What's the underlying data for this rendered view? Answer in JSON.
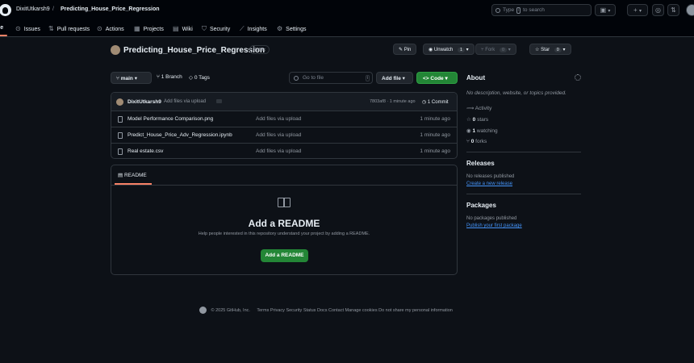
{
  "header": {
    "owner": "DixitUtkarsh9",
    "separator": "/",
    "repo": "Predicting_House_Price_Regression",
    "search_placeholder_pre": "Type",
    "search_key": "/",
    "search_placeholder_post": "to search",
    "plus": "+",
    "caret": "▾"
  },
  "tabs": [
    {
      "label": "de",
      "icon": "code-icon"
    },
    {
      "label": "Issues",
      "icon": "issue-icon"
    },
    {
      "label": "Pull requests",
      "icon": "pull-request-icon"
    },
    {
      "label": "Actions",
      "icon": "play-icon"
    },
    {
      "label": "Projects",
      "icon": "table-icon"
    },
    {
      "label": "Wiki",
      "icon": "book-icon"
    },
    {
      "label": "Security",
      "icon": "shield-icon"
    },
    {
      "label": "Insights",
      "icon": "graph-icon"
    },
    {
      "label": "Settings",
      "icon": "gear-icon"
    }
  ],
  "repo": {
    "title": "Predicting_House_Price_Regression",
    "visibility": "Public",
    "pin": "Pin",
    "unwatch": "Unwatch",
    "unwatch_count": "1",
    "fork": "Fork",
    "fork_count": "0",
    "star": "Star",
    "star_count": "0"
  },
  "filenav": {
    "branch": "main",
    "branch_count": "1 Branch",
    "tags": "0 Tags",
    "goto_placeholder": "Go to file",
    "goto_key": "t",
    "add_file": "Add file",
    "code": "Code"
  },
  "commit": {
    "user": "DixitUtkarsh9",
    "message": "Add files via upload",
    "sha_time": "7803af8 · 1 minute ago",
    "commits": "1 Commit"
  },
  "files": [
    {
      "name": "Model Performance Comparison.png",
      "message": "Add files via upload",
      "time": "1 minute ago"
    },
    {
      "name": "Predict_House_Price_Adv_Regression.ipynb",
      "message": "Add files via upload",
      "time": "1 minute ago"
    },
    {
      "name": "Real estate.csv",
      "message": "Add files via upload",
      "time": "1 minute ago"
    }
  ],
  "readme": {
    "tab": "README",
    "heading": "Add a README",
    "text": "Help people interested in this repository understand your project by adding a README.",
    "button": "Add a README"
  },
  "about": {
    "title": "About",
    "description": "No description, website, or topics provided.",
    "activity": "Activity",
    "stars_n": "0",
    "stars_label": "stars",
    "watching_n": "1",
    "watching_label": "watching",
    "forks_n": "0",
    "forks_label": "forks"
  },
  "releases": {
    "title": "Releases",
    "text": "No releases published",
    "link": "Create a new release"
  },
  "packages": {
    "title": "Packages",
    "text": "No packages published",
    "link": "Publish your first package"
  },
  "footer": {
    "copyright": "© 2025 GitHub, Inc.",
    "links": [
      "Terms",
      "Privacy",
      "Security",
      "Status",
      "Docs",
      "Contact",
      "Manage cookies",
      "Do not share my personal information"
    ]
  }
}
